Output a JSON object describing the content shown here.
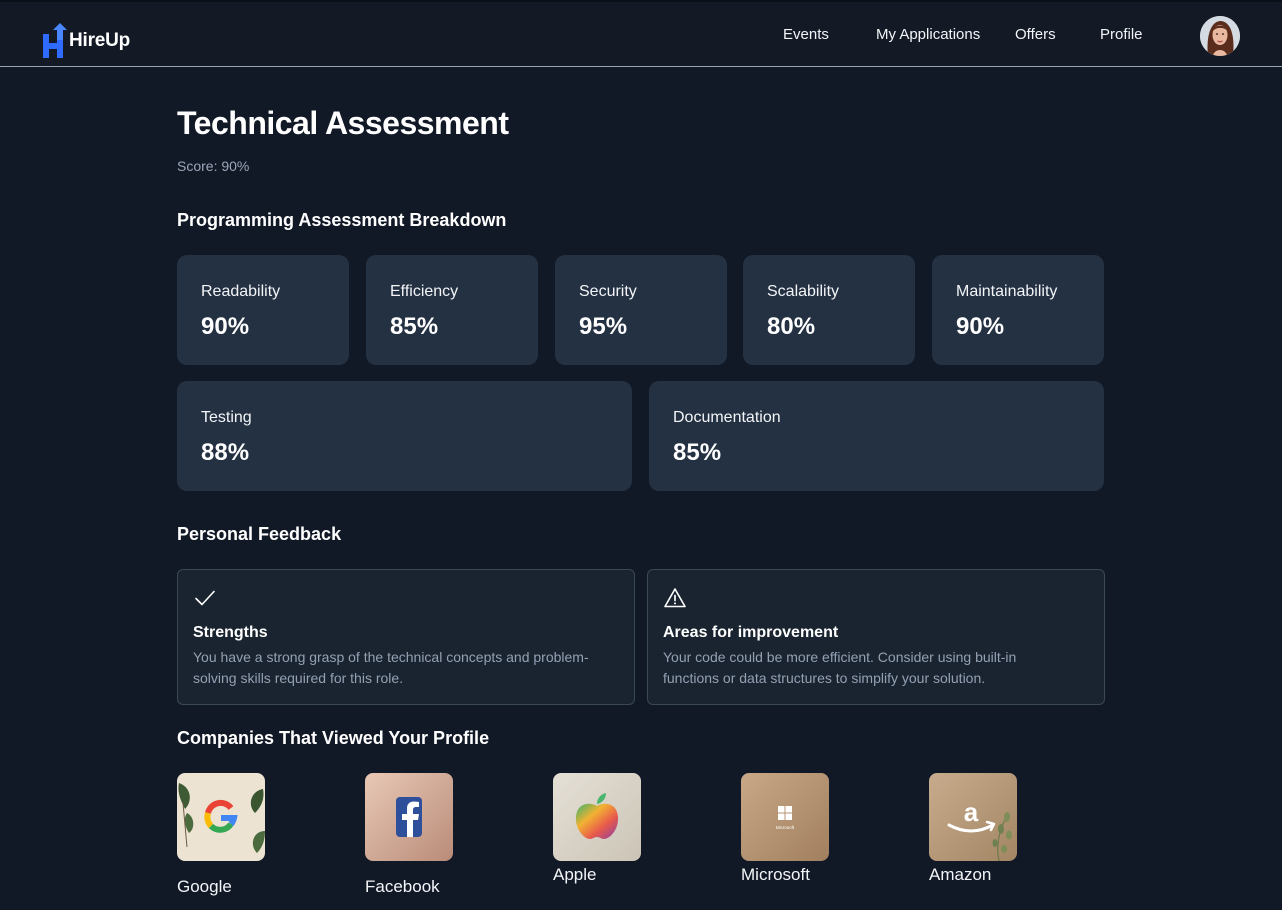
{
  "app": {
    "brand": "HireUp"
  },
  "nav": {
    "items": [
      {
        "label": "Events"
      },
      {
        "label": "My Applications"
      },
      {
        "label": "Offers"
      },
      {
        "label": "Profile"
      }
    ]
  },
  "page": {
    "title": "Technical Assessment",
    "score": "Score: 90%"
  },
  "breakdown": {
    "title": "Programming Assessment Breakdown",
    "metrics": [
      {
        "label": "Readability",
        "value": "90%"
      },
      {
        "label": "Efficiency",
        "value": "85%"
      },
      {
        "label": "Security",
        "value": "95%"
      },
      {
        "label": "Scalability",
        "value": "80%"
      },
      {
        "label": "Maintainability",
        "value": "90%"
      },
      {
        "label": "Testing",
        "value": "88%"
      },
      {
        "label": "Documentation",
        "value": "85%"
      }
    ]
  },
  "feedback": {
    "title": "Personal Feedback",
    "cards": [
      {
        "icon": "check-icon",
        "title": "Strengths",
        "text": "You have a strong grasp of the technical concepts and problem-solving skills required for this role."
      },
      {
        "icon": "warning-icon",
        "title": "Areas for improvement",
        "text": "Your code could be more efficient. Consider using built-in functions or data structures to simplify your solution."
      }
    ]
  },
  "companies": {
    "title": "Companies That Viewed Your Profile",
    "items": [
      {
        "name": "Google",
        "icon": "google-logo"
      },
      {
        "name": "Facebook",
        "icon": "facebook-logo"
      },
      {
        "name": "Apple",
        "icon": "apple-logo"
      },
      {
        "name": "Microsoft",
        "icon": "microsoft-logo",
        "caption": "Microsoft"
      },
      {
        "name": "Amazon",
        "icon": "amazon-logo",
        "caption": "a"
      }
    ]
  },
  "colors": {
    "background": "#111826",
    "card": "#243142",
    "feedback_card": "#1a2430",
    "accent": "#2f6bff"
  }
}
